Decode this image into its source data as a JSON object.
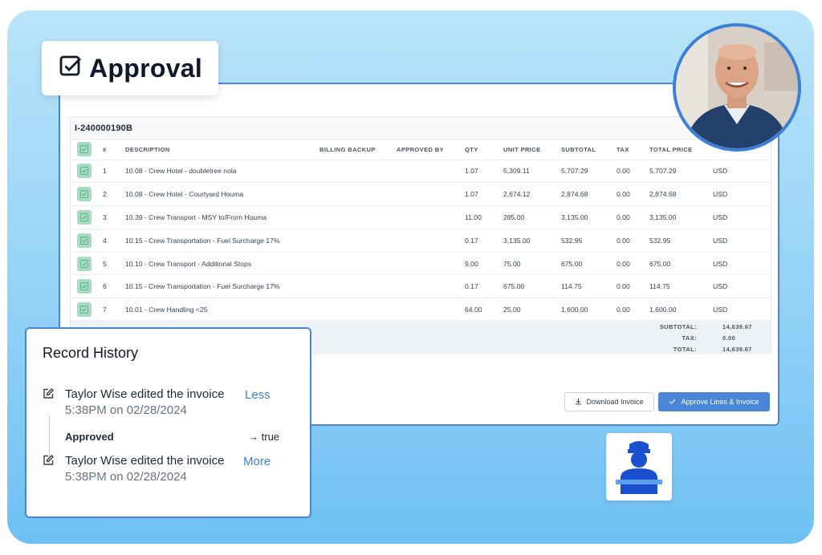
{
  "badge": {
    "title": "Approval",
    "icon": "checkbox-icon"
  },
  "invoice": {
    "id": "I-240000190B",
    "headers": [
      "#",
      "DESCRIPTION",
      "BILLING BACKUP",
      "APPROVED BY",
      "QTY",
      "UNIT PRICE",
      "SUBTOTAL",
      "TAX",
      "TOTAL PRICE",
      ""
    ],
    "rows": [
      {
        "num": "1",
        "description": "10.08 - Crew Hotel - doubletree nola",
        "billing_backup": "",
        "approved_by": "",
        "qty": "1.07",
        "unit_price": "5,309.11",
        "subtotal": "5,707.29",
        "tax": "0.00",
        "total_price": "5,707.29",
        "currency": "USD"
      },
      {
        "num": "2",
        "description": "10.08 - Crew Hotel - Courtyard Houma",
        "billing_backup": "",
        "approved_by": "",
        "qty": "1.07",
        "unit_price": "2,674.12",
        "subtotal": "2,874.68",
        "tax": "0.00",
        "total_price": "2,874.68",
        "currency": "USD"
      },
      {
        "num": "3",
        "description": "10.39 - Crew Transport - MSY to/From Houma",
        "billing_backup": "",
        "approved_by": "",
        "qty": "11.00",
        "unit_price": "285.00",
        "subtotal": "3,135.00",
        "tax": "0.00",
        "total_price": "3,135.00",
        "currency": "USD"
      },
      {
        "num": "4",
        "description": "10.15 - Crew Transportation - Fuel Surcharge 17%",
        "billing_backup": "",
        "approved_by": "",
        "qty": "0.17",
        "unit_price": "3,135.00",
        "subtotal": "532.95",
        "tax": "0.00",
        "total_price": "532.95",
        "currency": "USD"
      },
      {
        "num": "5",
        "description": "10.10 - Crew Transport - Additional Stops",
        "billing_backup": "",
        "approved_by": "",
        "qty": "9.00",
        "unit_price": "75.00",
        "subtotal": "675.00",
        "tax": "0.00",
        "total_price": "675.00",
        "currency": "USD"
      },
      {
        "num": "6",
        "description": "10.15 - Crew Transportation - Fuel Surcharge 17%",
        "billing_backup": "",
        "approved_by": "",
        "qty": "0.17",
        "unit_price": "675.00",
        "subtotal": "114.75",
        "tax": "0.00",
        "total_price": "114.75",
        "currency": "USD"
      },
      {
        "num": "7",
        "description": "10.01 - Crew Handling <25",
        "billing_backup": "",
        "approved_by": "",
        "qty": "64.00",
        "unit_price": "25.00",
        "subtotal": "1,600.00",
        "tax": "0.00",
        "total_price": "1,600.00",
        "currency": "USD"
      }
    ],
    "totals": {
      "subtotal_label": "SUBTOTAL:",
      "subtotal": "14,639.67",
      "tax_label": "TAX:",
      "tax": "0.00",
      "total_label": "TOTAL:",
      "total": "14,639.67"
    },
    "download_label": "Download Invoice",
    "approve_label": "Approve Lines & Invoice"
  },
  "history": {
    "title": "Record History",
    "entries": [
      {
        "text": "Taylor Wise edited the invoice",
        "time": "5:38PM on 02/28/2024",
        "link": "Less"
      },
      {
        "text": "Taylor Wise edited the invoice",
        "time": "5:38PM on 02/28/2024",
        "link": "More"
      }
    ],
    "change": {
      "field": "Approved",
      "value": "true"
    }
  },
  "colors": {
    "accent": "#4a86d8",
    "check_green": "#a7dcc3",
    "background_blue": "#93d2f7"
  }
}
